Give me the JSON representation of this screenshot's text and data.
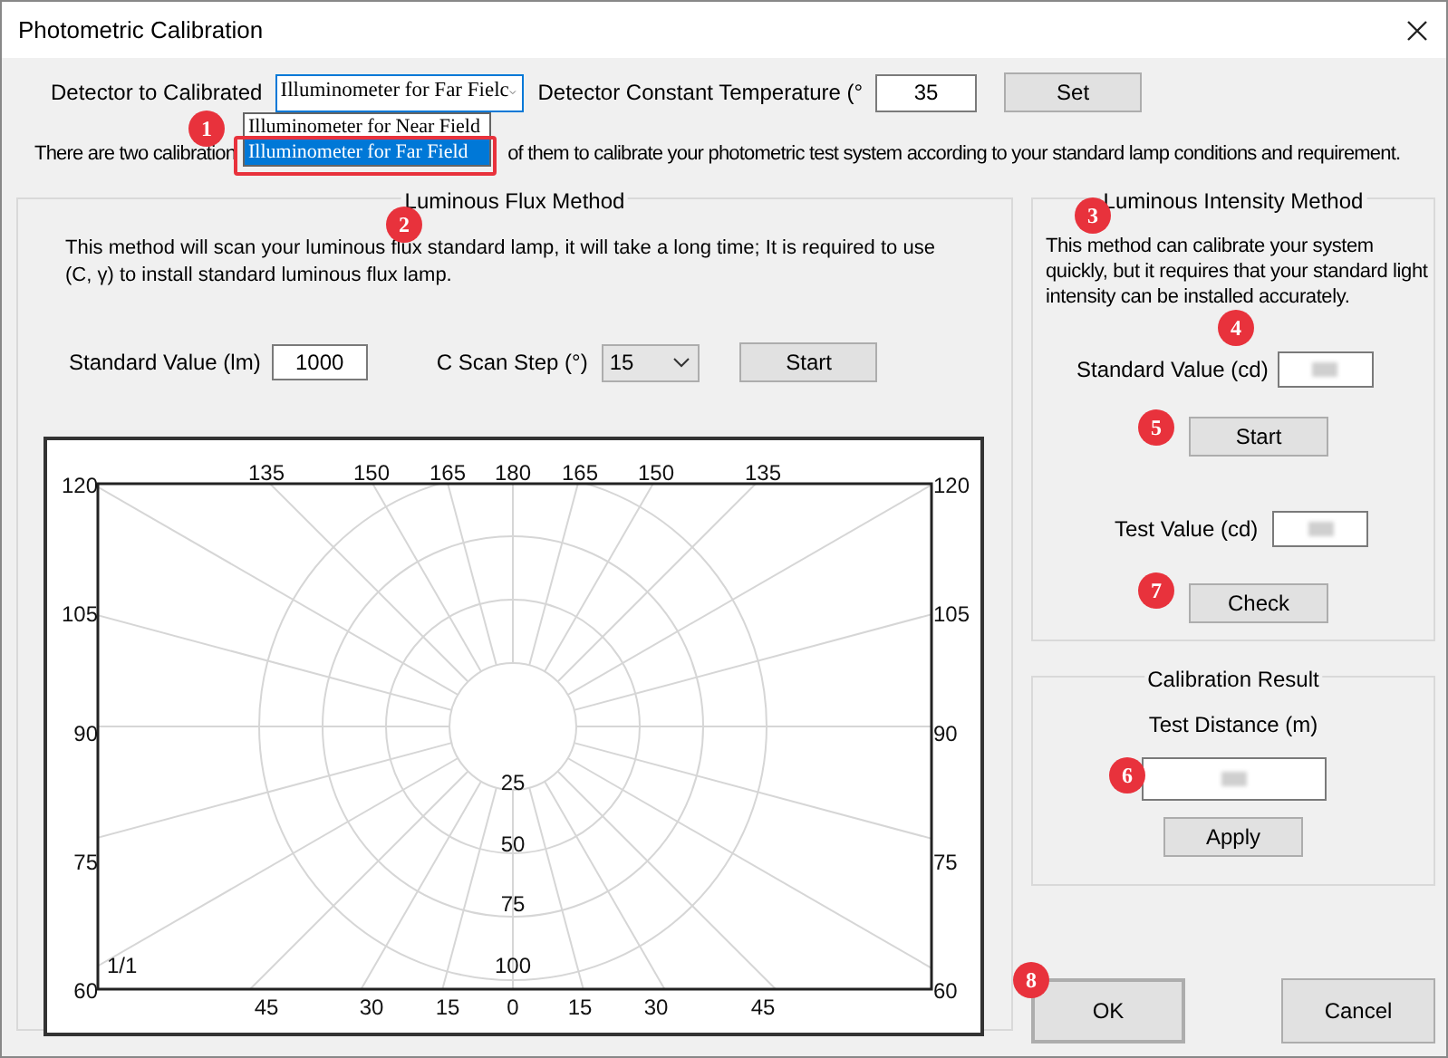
{
  "window": {
    "title": "Photometric Calibration"
  },
  "detector": {
    "label": "Detector to Calibrated",
    "value": "Illuminometer for Far Fielc",
    "options": [
      {
        "label": "Illuminometer for Near Field",
        "selected": false
      },
      {
        "label": "Illuminometer for Far Field",
        "selected": true
      }
    ]
  },
  "temperature": {
    "label": "Detector Constant Temperature (°",
    "value": "35",
    "button": "Set"
  },
  "info": [
    "There are two calibration",
    "of them to calibrate your photometric test system according to your standard lamp conditions and requirement."
  ],
  "flux_method": {
    "title": "Luminous Flux Method",
    "description": "This method will scan your luminous flux standard lamp, it will take a long time; It is required to use (C, γ) to install standard luminous flux lamp.",
    "standard_value": {
      "label": "Standard Value (lm)",
      "value": "1000"
    },
    "c_scan_step": {
      "label": "C Scan Step (°)",
      "value": "15"
    },
    "start_button": "Start",
    "polar_plot": {
      "top_labels": [
        "135",
        "150",
        "165",
        "180",
        "165",
        "150",
        "135"
      ],
      "bottom_labels": [
        "45",
        "30",
        "15",
        "0",
        "15",
        "30",
        "45"
      ],
      "left_labels": [
        "120",
        "105",
        "90",
        "75",
        "60"
      ],
      "right_labels": [
        "120",
        "105",
        "90",
        "75",
        "60"
      ],
      "ring_labels": [
        "25",
        "50",
        "75",
        "100"
      ],
      "page": "1/1"
    }
  },
  "intensity_method": {
    "title": "Luminous Intensity Method",
    "description": "This method can calibrate your system quickly, but it requires that your standard light intensity can be installed accurately.",
    "standard_value": {
      "label": "Standard Value (cd)"
    },
    "start_button": "Start",
    "test_value": {
      "label": "Test Value (cd)"
    },
    "check_button": "Check"
  },
  "calibration_result": {
    "title": "Calibration Result",
    "test_distance": {
      "label": "Test Distance (m)"
    },
    "apply_button": "Apply"
  },
  "ok_button": "OK",
  "cancel_button": "Cancel",
  "markers": [
    "1",
    "2",
    "3",
    "4",
    "5",
    "6",
    "7",
    "8"
  ]
}
